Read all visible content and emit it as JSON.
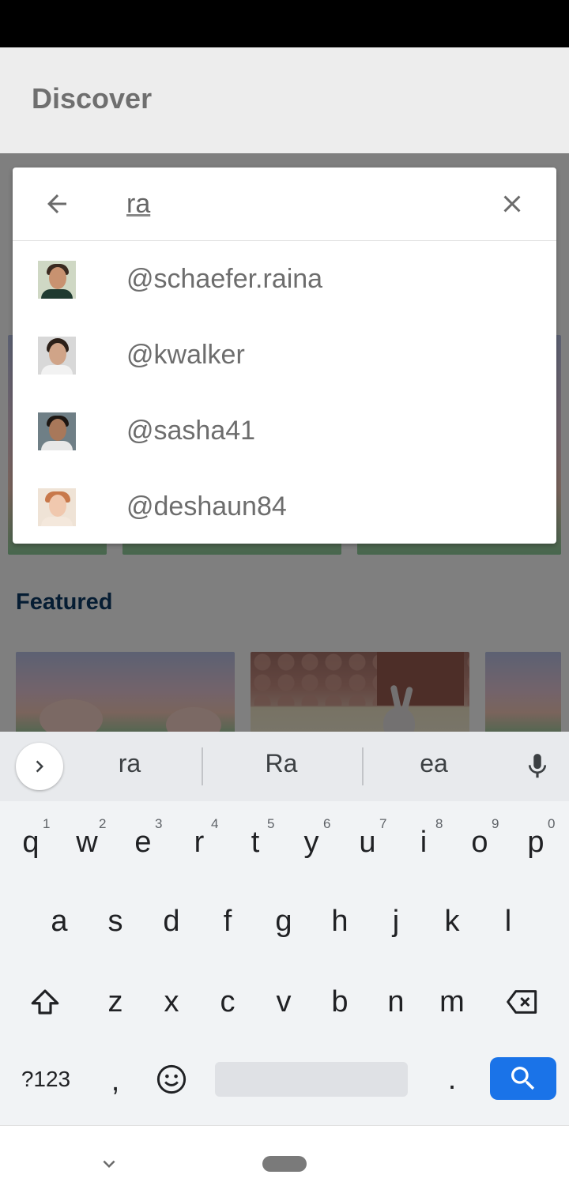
{
  "app": {
    "title": "Discover",
    "featured_label": "Featured"
  },
  "search": {
    "query": "ra",
    "back_icon": "arrow-left-icon",
    "clear_icon": "close-icon",
    "results": [
      {
        "handle": "@schaefer.raina",
        "avatar": "avatar-woman-dark-hair"
      },
      {
        "handle": "@kwalker",
        "avatar": "avatar-man-curly-hair"
      },
      {
        "handle": "@sasha41",
        "avatar": "avatar-man-short-hair"
      },
      {
        "handle": "@deshaun84",
        "avatar": "avatar-woman-red-hair"
      }
    ]
  },
  "keyboard": {
    "suggestions": [
      "ra",
      "Ra",
      "ea"
    ],
    "row1": [
      {
        "key": "q",
        "hint": "1"
      },
      {
        "key": "w",
        "hint": "2"
      },
      {
        "key": "e",
        "hint": "3"
      },
      {
        "key": "r",
        "hint": "4"
      },
      {
        "key": "t",
        "hint": "5"
      },
      {
        "key": "y",
        "hint": "6"
      },
      {
        "key": "u",
        "hint": "7"
      },
      {
        "key": "i",
        "hint": "8"
      },
      {
        "key": "o",
        "hint": "9"
      },
      {
        "key": "p",
        "hint": "0"
      }
    ],
    "row2": [
      "a",
      "s",
      "d",
      "f",
      "g",
      "h",
      "j",
      "k",
      "l"
    ],
    "row3": [
      "z",
      "x",
      "c",
      "v",
      "b",
      "n",
      "m"
    ],
    "symbols_label": "?123",
    "comma_label": ",",
    "period_label": "."
  },
  "colors": {
    "accent": "#1a73e8",
    "featured": "#0d3b66"
  }
}
